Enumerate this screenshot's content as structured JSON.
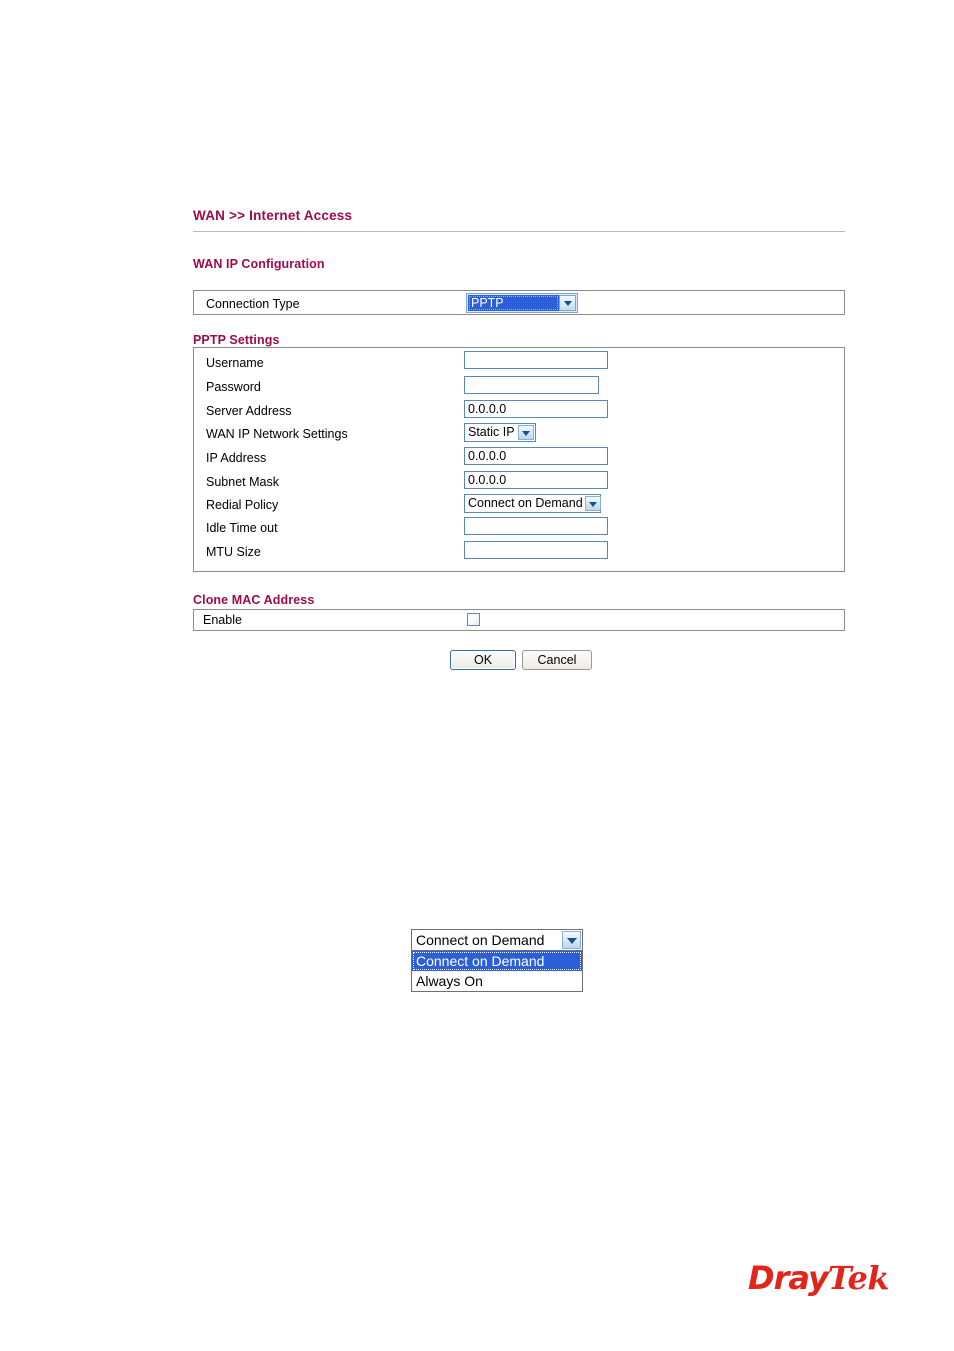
{
  "page": {
    "title": "WAN >> Internet Access",
    "accent_color": "#9E0B4B",
    "brand_color": "#E1251B"
  },
  "wan_ip_configuration": {
    "heading": "WAN IP Configuration",
    "connection_type": {
      "label": "Connection Type",
      "value": "PPTP"
    }
  },
  "pptp_settings": {
    "heading": "PPTP Settings",
    "fields": [
      {
        "label": "Username",
        "value": "",
        "type": "text"
      },
      {
        "label": "Password",
        "value": "",
        "type": "password"
      },
      {
        "label": "Server Address",
        "value": "0.0.0.0",
        "type": "text"
      },
      {
        "label": "WAN IP Network Settings",
        "value": "Static IP",
        "type": "select"
      },
      {
        "label": "IP Address",
        "value": "0.0.0.0",
        "type": "text"
      },
      {
        "label": "Subnet Mask",
        "value": "0.0.0.0",
        "type": "text"
      },
      {
        "label": "Redial Policy",
        "value": "Connect on Demand",
        "type": "select"
      },
      {
        "label": "Idle Time out",
        "value": "",
        "type": "text"
      },
      {
        "label": "MTU Size",
        "value": "",
        "type": "text"
      }
    ]
  },
  "clone_mac_address": {
    "heading": "Clone MAC Address",
    "enable_label": "Enable",
    "enabled": false
  },
  "buttons": {
    "ok": "OK",
    "cancel": "Cancel"
  },
  "redial_policy_dropdown": {
    "selected": "Connect on Demand",
    "options": [
      "Connect on Demand",
      "Always On"
    ]
  },
  "logo": {
    "part1": "Dray",
    "part2": "Tek"
  }
}
